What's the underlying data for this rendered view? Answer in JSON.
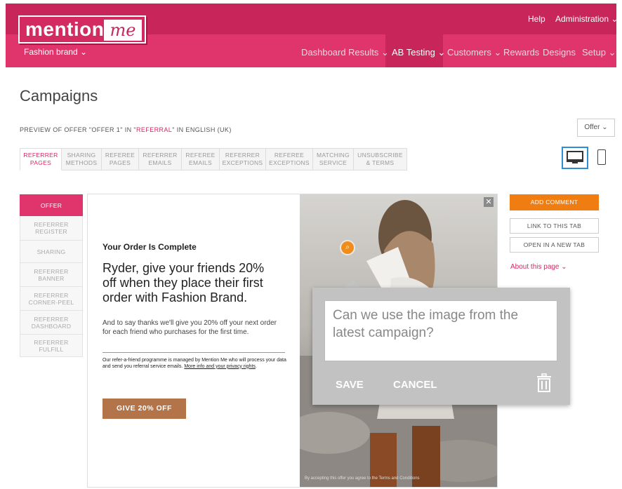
{
  "header": {
    "logo_text": "mention",
    "logo_me": "me",
    "help": "Help",
    "administration": "Administration ⌄",
    "brand": "Fashion brand ⌄"
  },
  "nav": [
    "Dashboard",
    "Results ⌄",
    "AB Testing ⌄",
    "Customers ⌄",
    "Rewards",
    "Designs",
    "Setup ⌄"
  ],
  "page": {
    "title": "Campaigns",
    "preview_prefix": "PREVIEW OF OFFER \"OFFER 1\" IN \"",
    "preview_highlight": "REFERRAL",
    "preview_suffix": "\" IN ENGLISH (UK)",
    "offer_button": "Offer ⌄"
  },
  "tabs": [
    {
      "line1": "REFERRER",
      "line2": "PAGES"
    },
    {
      "line1": "SHARING",
      "line2": "METHODS"
    },
    {
      "line1": "REFEREE",
      "line2": "PAGES"
    },
    {
      "line1": "REFERRER",
      "line2": "EMAILS"
    },
    {
      "line1": "REFEREE",
      "line2": "EMAILS"
    },
    {
      "line1": "REFERRER",
      "line2": "EXCEPTIONS"
    },
    {
      "line1": "REFEREE",
      "line2": "EXCEPTIONS"
    },
    {
      "line1": "MATCHING",
      "line2": "SERVICE"
    },
    {
      "line1": "UNSUBSCRIBE",
      "line2": "& TERMS"
    }
  ],
  "leftnav": [
    {
      "line1": "OFFER",
      "line2": ""
    },
    {
      "line1": "REFERRER",
      "line2": "REGISTER"
    },
    {
      "line1": "SHARING",
      "line2": ""
    },
    {
      "line1": "REFERRER",
      "line2": "BANNER"
    },
    {
      "line1": "REFERRER",
      "line2": "CORNER-PEEL"
    },
    {
      "line1": "REFERRER",
      "line2": "DASHBOARD"
    },
    {
      "line1": "REFERRER",
      "line2": "FULFILL"
    }
  ],
  "preview": {
    "order_title": "Your Order Is Complete",
    "headline": "Ryder, give your friends 20% off when they place their first order with Fashion Brand.",
    "body": "And to say thanks we'll give you 20% off your next order for each friend who purchases for the first time.",
    "small": "Our refer-a-friend programme is managed by Mention Me who will process your data and send you referral service emails. ",
    "small_link": "More info and your privacy rights",
    "small_end": ".",
    "cta": "GIVE 20% OFF",
    "photo_footer": "By accepting this offer you agree to the Terms and Conditions",
    "close": "✕",
    "zoom": "⌕"
  },
  "comment": {
    "text": "Can we use the image from the latest campaign?",
    "save": "SAVE",
    "cancel": "CANCEL"
  },
  "actions": {
    "add_comment": "ADD COMMENT",
    "link_tab": "LINK TO THIS TAB",
    "open_tab": "OPEN IN A NEW TAB",
    "about": "About this page ⌄"
  },
  "colors": {
    "brand": "#e0356c",
    "brand_dark": "#c8255a",
    "accent_orange": "#f07d12",
    "cta_brown": "#b27448"
  }
}
